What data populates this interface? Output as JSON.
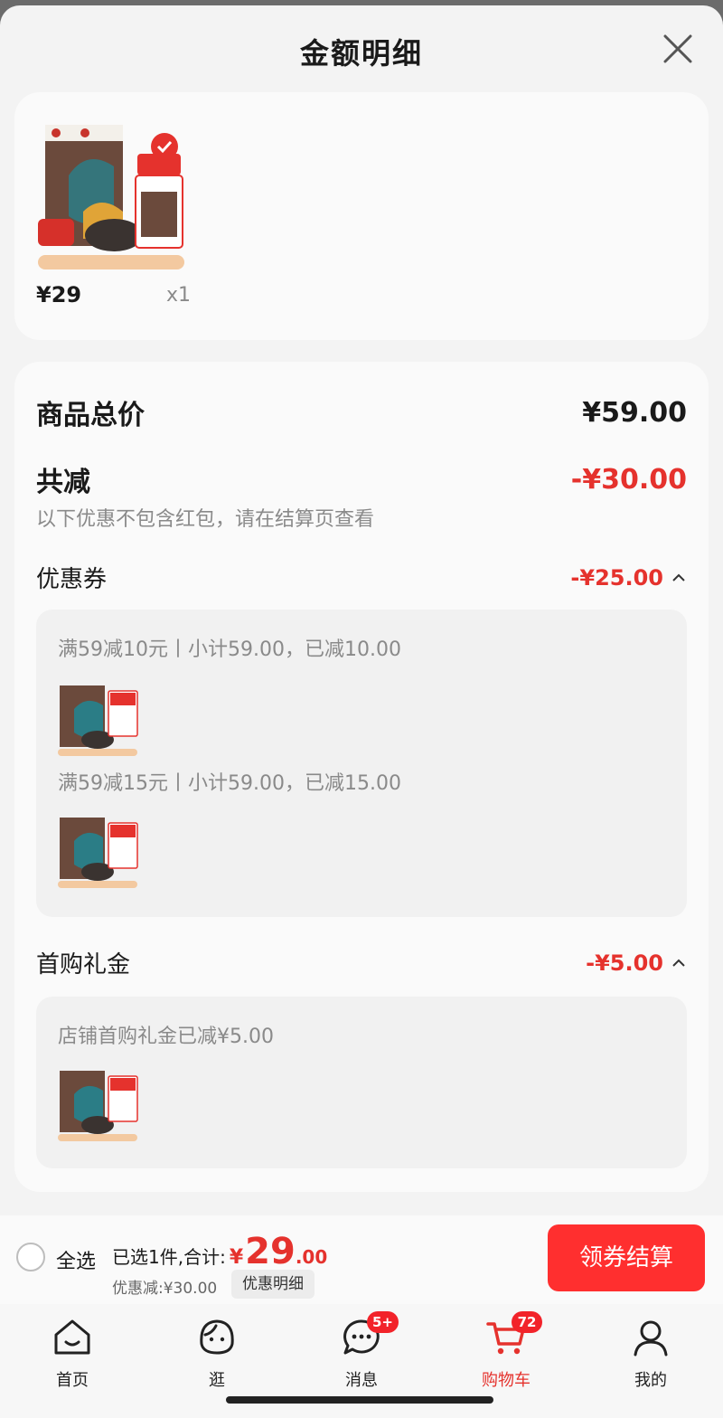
{
  "header": {
    "title": "金额明细"
  },
  "product": {
    "price": "¥29",
    "quantity": "x1"
  },
  "summary": {
    "total_label": "商品总价",
    "total_value": "¥59.00",
    "reduce_label": "共减",
    "reduce_value": "-¥30.00",
    "note": "以下优惠不包含红包，请在结算页查看",
    "coupon": {
      "label": "优惠券",
      "value": "-¥25.00",
      "rules": [
        "满59减10元丨小计59.00，已减10.00",
        "满59减15元丨小计59.00，已减15.00"
      ]
    },
    "gift": {
      "label": "首购礼金",
      "value": "-¥5.00",
      "rules": [
        "店铺首购礼金已减¥5.00"
      ]
    }
  },
  "bottom_bar": {
    "select_all": "全选",
    "selected_prefix": "已选1件,合计:",
    "currency": "¥",
    "amount_int": "29",
    "amount_dec": ".00",
    "discount": "优惠减:¥30.00",
    "detail_button": "优惠明细",
    "checkout_button": "领券结算"
  },
  "tabbar": {
    "items": [
      {
        "label": "首页",
        "icon": "home-icon"
      },
      {
        "label": "逛",
        "icon": "browse-icon"
      },
      {
        "label": "消息",
        "icon": "message-icon",
        "badge": "5+"
      },
      {
        "label": "购物车",
        "icon": "cart-icon",
        "badge": "72",
        "active": true
      },
      {
        "label": "我的",
        "icon": "profile-icon"
      }
    ]
  },
  "colors": {
    "accent": "#e5322d",
    "checkout": "#ff2f2f",
    "badge": "#f2232a"
  }
}
